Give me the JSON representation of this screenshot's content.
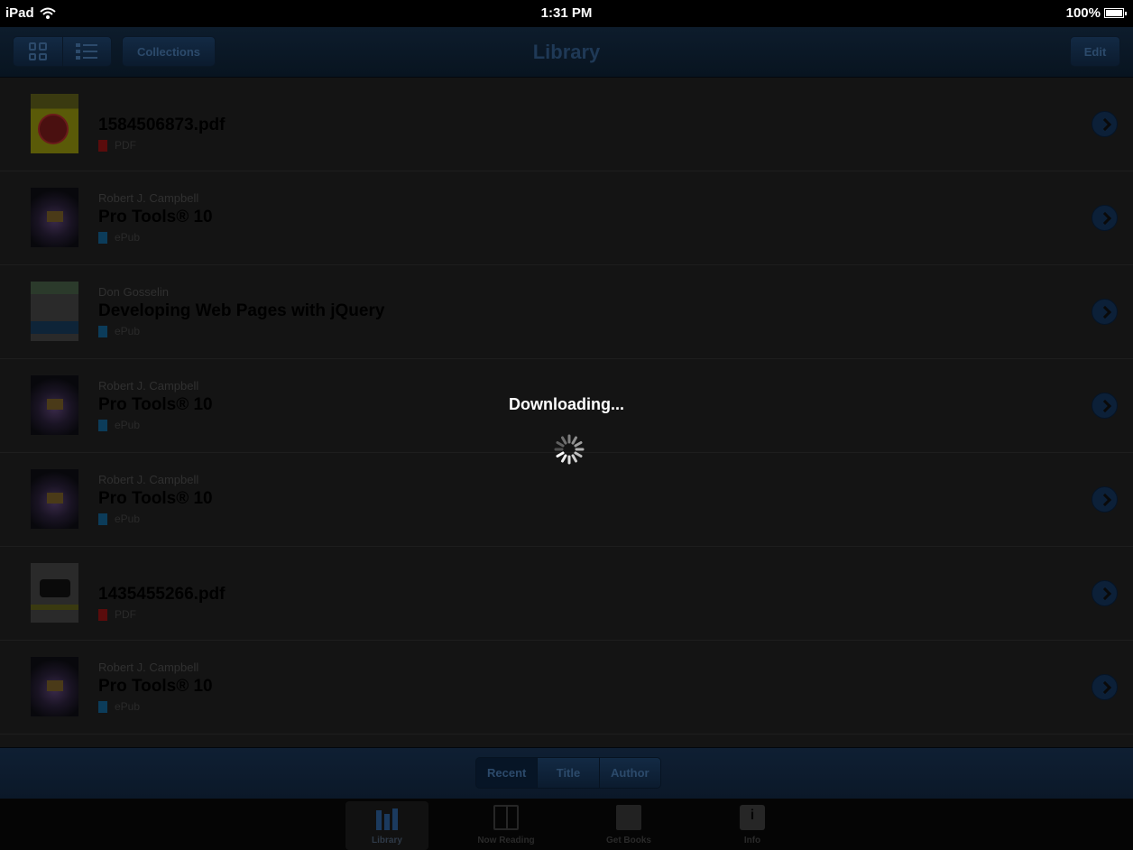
{
  "status_bar": {
    "device": "iPad",
    "time": "1:31 PM",
    "battery": "100%"
  },
  "nav": {
    "title": "Library",
    "collections_label": "Collections",
    "edit_label": "Edit"
  },
  "books": [
    {
      "author": "",
      "title": "1584506873.pdf",
      "format": "PDF",
      "thumb": "pdf1"
    },
    {
      "author": "Robert J. Campbell",
      "title": "Pro Tools® 10",
      "format": "ePub",
      "thumb": "protools"
    },
    {
      "author": "Don Gosselin",
      "title": "Developing Web Pages with jQuery",
      "format": "ePub",
      "thumb": "jquery"
    },
    {
      "author": "Robert J. Campbell",
      "title": "Pro Tools® 10",
      "format": "ePub",
      "thumb": "protools"
    },
    {
      "author": "Robert J. Campbell",
      "title": "Pro Tools® 10",
      "format": "ePub",
      "thumb": "protools"
    },
    {
      "author": "",
      "title": "1435455266.pdf",
      "format": "PDF",
      "thumb": "nikon"
    },
    {
      "author": "Robert J. Campbell",
      "title": "Pro Tools® 10",
      "format": "ePub",
      "thumb": "protools"
    }
  ],
  "sort": {
    "recent": "Recent",
    "title": "Title",
    "author": "Author",
    "selected": "Recent"
  },
  "tabs": {
    "library": "Library",
    "now_reading": "Now Reading",
    "get_books": "Get Books",
    "info": "Info",
    "selected": "Library"
  },
  "overlay": {
    "message": "Downloading..."
  }
}
